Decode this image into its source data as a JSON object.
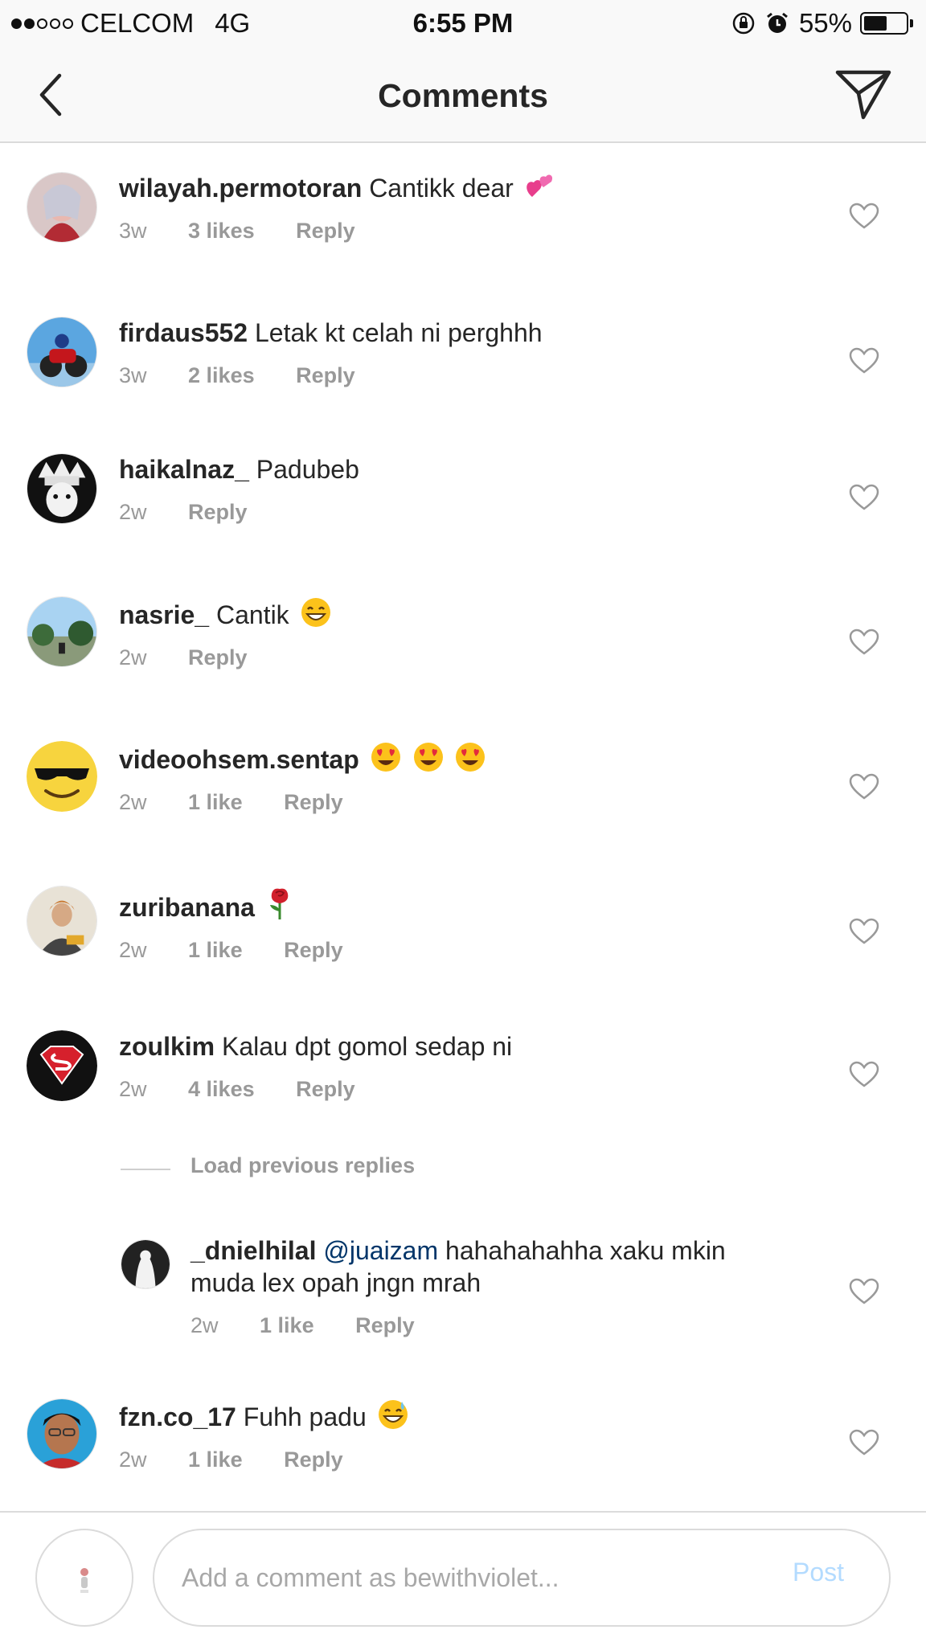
{
  "status_bar": {
    "signal_dots": 5,
    "signal_filled": 2,
    "carrier": "CELCOM",
    "network": "4G",
    "time": "6:55 PM",
    "battery": "55%",
    "battery_level": 0.55
  },
  "nav": {
    "title": "Comments",
    "back_icon": "chevron-left-icon",
    "send_icon": "paper-plane-icon"
  },
  "comments": [
    {
      "username": "wilayah.permotoran",
      "text": "Cantikk dear",
      "emoji": "two-hearts",
      "time": "3w",
      "likes": "3 likes",
      "reply": "Reply"
    },
    {
      "username": "firdaus552",
      "text": "Letak kt celah ni perghhh",
      "time": "3w",
      "likes": "2 likes",
      "reply": "Reply"
    },
    {
      "username": "haikalnaz_",
      "text": "Padubeb",
      "time": "2w",
      "reply": "Reply"
    },
    {
      "username": "nasrie_",
      "text": "Cantik",
      "emoji": "grinning-face",
      "time": "2w",
      "reply": "Reply"
    },
    {
      "username": "videoohsem.sentap",
      "text": "",
      "emoji": "heart-eyes x3",
      "time": "2w",
      "likes": "1 like",
      "reply": "Reply"
    },
    {
      "username": "zuribanana",
      "text": "",
      "emoji": "rose",
      "time": "2w",
      "likes": "1 like",
      "reply": "Reply"
    },
    {
      "username": "zoulkim",
      "text": "Kalau dpt gomol sedap ni",
      "time": "2w",
      "likes": "4 likes",
      "reply": "Reply"
    },
    {
      "username": "fzn.co_17",
      "text": "Fuhh padu",
      "emoji": "grinning-sweat",
      "time": "2w",
      "likes": "1 like",
      "reply": "Reply"
    }
  ],
  "load_previous": "Load previous replies",
  "reply_comment": {
    "username": "_dnielhilal",
    "mention": "@juaizam",
    "text": "hahahahahha xaku mkin muda lex opah jngn mrah",
    "time": "2w",
    "likes": "1 like",
    "reply": "Reply"
  },
  "composer": {
    "placeholder": "Add a comment as bewithviolet...",
    "post_label": "Post"
  },
  "colors": {
    "text": "#262626",
    "meta": "#999999",
    "mention": "#003569",
    "post_disabled": "#b3dbff",
    "divider": "#dbdbdb"
  }
}
